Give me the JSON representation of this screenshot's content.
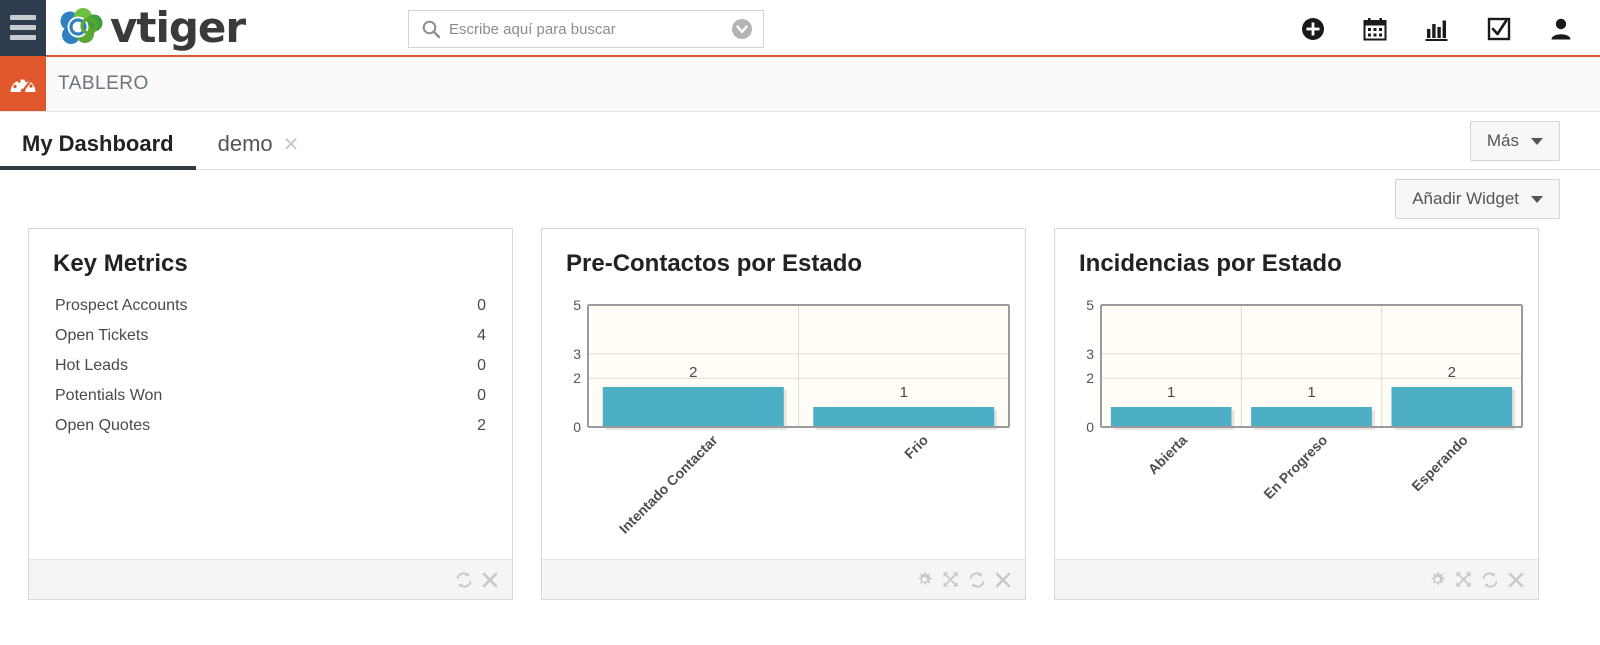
{
  "brand": {
    "name": "vtiger",
    "accent_orange": "#e0572c",
    "logo_blue": "#2f7fc1",
    "logo_green": "#5aa832"
  },
  "topbar": {
    "menu_icon": "hamburger-icon",
    "search": {
      "placeholder": "Escribe aquí para buscar",
      "value": "",
      "icon": "search-icon",
      "dropdown_icon": "chevron-down-circle-icon"
    },
    "icons": [
      {
        "name": "add-circle-icon",
        "label": "Añadir"
      },
      {
        "name": "calendar-icon",
        "label": "Calendario"
      },
      {
        "name": "bar-chart-icon",
        "label": "Informes"
      },
      {
        "name": "checkbox-check-icon",
        "label": "Tareas"
      },
      {
        "name": "user-icon",
        "label": "Usuario"
      }
    ]
  },
  "modulebar": {
    "icon": "dashboard-gauge-icon",
    "title": "TABLERO"
  },
  "tabs": {
    "items": [
      {
        "label": "My Dashboard",
        "active": true,
        "closable": false
      },
      {
        "label": "demo",
        "active": false,
        "closable": true,
        "close_icon": "close-icon"
      }
    ],
    "more_button": {
      "label": "Más",
      "icon": "caret-down-icon"
    }
  },
  "toolbar": {
    "add_widget_button": {
      "label": "Añadir Widget",
      "icon": "caret-down-icon"
    }
  },
  "panels": [
    {
      "id": "key-metrics",
      "title": "Key Metrics",
      "type": "metrics",
      "rows": [
        {
          "label": "Prospect Accounts",
          "value": "0"
        },
        {
          "label": "Open Tickets",
          "value": "4"
        },
        {
          "label": "Hot Leads",
          "value": "0"
        },
        {
          "label": "Potentials Won",
          "value": "0"
        },
        {
          "label": "Open Quotes",
          "value": "2"
        }
      ],
      "footer_icons": [
        "refresh-icon",
        "close-icon"
      ]
    },
    {
      "id": "pre-contactos-por-estado",
      "title": "Pre-Contactos por Estado",
      "type": "chart",
      "footer_icons": [
        "gear-icon",
        "expand-icon",
        "refresh-icon",
        "close-icon"
      ]
    },
    {
      "id": "incidencias-por-estado",
      "title": "Incidencias por Estado",
      "type": "chart",
      "footer_icons": [
        "gear-icon",
        "expand-icon",
        "refresh-icon",
        "close-icon"
      ]
    }
  ],
  "chart_data": [
    {
      "type": "bar",
      "title": "Pre-Contactos por Estado",
      "categories": [
        "Intentado Contactar",
        "Frio"
      ],
      "values": [
        2,
        1
      ],
      "data_labels": [
        "2",
        "1"
      ],
      "xlabel": "",
      "ylabel": "",
      "ylim": [
        0,
        5
      ],
      "yticks": [
        0,
        2,
        3,
        5
      ],
      "ytick_labels": [
        "0",
        "2",
        "3",
        "5"
      ],
      "grid": true,
      "legend": "none",
      "bar_color": "#4cafc5",
      "plot_bg": "#fffdf6"
    },
    {
      "type": "bar",
      "title": "Incidencias por Estado",
      "categories": [
        "Abierta",
        "En Progreso",
        "Esperando"
      ],
      "values": [
        1,
        1,
        2
      ],
      "data_labels": [
        "1",
        "1",
        "2"
      ],
      "xlabel": "",
      "ylabel": "",
      "ylim": [
        0,
        5
      ],
      "yticks": [
        0,
        2,
        3,
        5
      ],
      "ytick_labels": [
        "0",
        "2",
        "3",
        "5"
      ],
      "grid": true,
      "legend": "none",
      "bar_color": "#4cafc5",
      "plot_bg": "#fffdf6"
    }
  ]
}
